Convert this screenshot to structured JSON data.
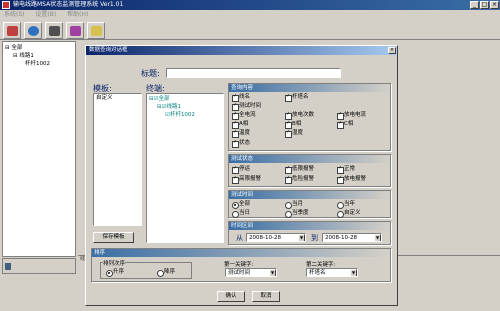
{
  "app": {
    "title": "输电线路MSA状态监测管理系统 Ver1.01"
  },
  "window_buttons": [
    "_",
    "□",
    "×"
  ],
  "menu": [
    "系统(S)",
    "设置(B)",
    "帮助(H)"
  ],
  "toolbar_icons": [
    "print-icon",
    "search-icon",
    "query-icon",
    "eraser-icon",
    "home-icon"
  ],
  "tree": {
    "root": "全部",
    "line": "线路1",
    "tower": "杆杆1002"
  },
  "background_row_text": "线路1",
  "dialog": {
    "title": "数据查询对话框",
    "close": "×",
    "subject_label": "标题:",
    "subject_value": "",
    "template_label": "模板:",
    "template_items": [
      "自定义"
    ],
    "terminal_label": "终端:",
    "terminal_tree": {
      "root": "全部",
      "line": "线路1",
      "tower": "杆杆1002"
    },
    "save_template": "保存模板",
    "query_content": {
      "title": "查询内容",
      "items": [
        {
          "label": "线名",
          "checked": true
        },
        {
          "label": "杆塔名",
          "checked": true
        },
        {
          "label": "测试时间",
          "checked": true
        },
        {
          "label": "全电流",
          "checked": true
        },
        {
          "label": "放电次数",
          "checked": true
        },
        {
          "label": "放电电流",
          "checked": true
        },
        {
          "label": "A相",
          "checked": true
        },
        {
          "label": "B相",
          "checked": true
        },
        {
          "label": "C相",
          "checked": true
        },
        {
          "label": "温度",
          "checked": true
        },
        {
          "label": "湿度",
          "checked": true
        },
        {
          "label": "状态",
          "checked": true
        }
      ]
    },
    "test_status": {
      "title": "测试状态",
      "items": [
        {
          "label": "停运",
          "checked": true
        },
        {
          "label": "低限报警",
          "checked": true
        },
        {
          "label": "正常",
          "checked": true
        },
        {
          "label": "高限报警",
          "checked": true
        },
        {
          "label": "危险报警",
          "checked": true
        },
        {
          "label": "放电报警",
          "checked": true
        }
      ]
    },
    "test_time": {
      "title": "测试时间",
      "options": [
        "全部",
        "当月",
        "当年",
        "当日",
        "当季度",
        "自定义"
      ],
      "selected": "全部"
    },
    "time_range": {
      "title": "时间区间",
      "from_label": "从",
      "to_label": "到",
      "from": "2008-10-28",
      "to": "2008-10-28"
    },
    "sort": {
      "title": "排序",
      "order_label": "排列次序",
      "options": [
        "升序",
        "降序"
      ],
      "selected": "升序",
      "key1_label": "第一关键字:",
      "key1_value": "测试时间",
      "key2_label": "第二关键字:",
      "key2_value": "杆塔名"
    },
    "ok": "确认",
    "cancel": "取消"
  },
  "colors": {
    "titlebar": "#0a246a",
    "face": "#d4d0c8",
    "tree_text": "#008080"
  }
}
